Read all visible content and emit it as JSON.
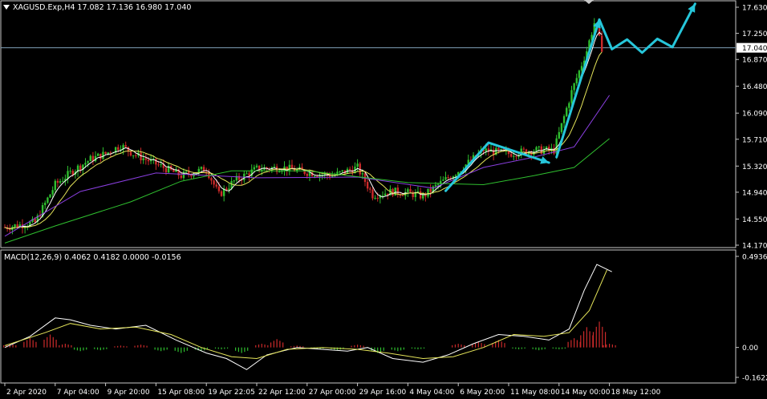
{
  "colors": {
    "background": "#000000",
    "frame": "#c8c8c8",
    "text": "#ffffff",
    "bull_candle": "#2fbf2f",
    "bear_candle": "#cc2a2a",
    "price_line": "#7f9fb8",
    "ma_fast": "#ffffff",
    "ma_mid": "#e6e65a",
    "ma_slow": "#8a3fe0",
    "ma_long": "#2fbf2f",
    "arrow": "#26c6da",
    "macd_line": "#ffffff",
    "signal_line": "#e6e65a",
    "hist_pos": "#cc2a2a",
    "hist_neg": "#2fbf2f"
  },
  "icons": {
    "symbol_marker": "triangle-down-icon",
    "scroll_marker": "triangle-down-icon"
  },
  "chart_data": [
    {
      "type": "candlestick",
      "title": "XAGUSD.Exp,H4  17.082 17.136 16.980 17.040",
      "current_price": 17.04,
      "current_price_label": "17.040",
      "yticks": [
        "17.630",
        "17.250",
        "16.870",
        "16.480",
        "16.090",
        "15.710",
        "15.320",
        "14.940",
        "14.550",
        "14.170"
      ],
      "ytick_values": [
        17.63,
        17.25,
        16.87,
        16.48,
        16.09,
        15.71,
        15.32,
        14.94,
        14.55,
        14.17
      ],
      "ylim": [
        14.17,
        17.63
      ],
      "x_categories": [
        "2 Apr 2020",
        "7 Apr 04:00",
        "9 Apr 20:00",
        "15 Apr 08:00",
        "19 Apr 22:05",
        "22 Apr 12:00",
        "27 Apr 00:00",
        "29 Apr 16:00",
        "4 May 04:00",
        "6 May 20:00",
        "11 May 08:00",
        "14 May 00:00",
        "18 May 12:00"
      ],
      "price_path": [
        {
          "t": 0,
          "v": 14.43
        },
        {
          "t": 0.6,
          "v": 14.5
        },
        {
          "t": 1.0,
          "v": 15.05
        },
        {
          "t": 1.35,
          "v": 15.25
        },
        {
          "t": 1.7,
          "v": 15.42
        },
        {
          "t": 2.0,
          "v": 15.5
        },
        {
          "t": 2.3,
          "v": 15.62
        },
        {
          "t": 2.55,
          "v": 15.5
        },
        {
          "t": 2.85,
          "v": 15.4
        },
        {
          "t": 3.0,
          "v": 15.35
        },
        {
          "t": 3.5,
          "v": 15.18
        },
        {
          "t": 4.0,
          "v": 15.28
        },
        {
          "t": 4.25,
          "v": 14.9
        },
        {
          "t": 4.55,
          "v": 15.1
        },
        {
          "t": 5.0,
          "v": 15.28
        },
        {
          "t": 5.5,
          "v": 15.3
        },
        {
          "t": 6.0,
          "v": 15.23
        },
        {
          "t": 6.5,
          "v": 15.18
        },
        {
          "t": 7.0,
          "v": 15.3
        },
        {
          "t": 7.3,
          "v": 14.9
        },
        {
          "t": 7.7,
          "v": 14.95
        },
        {
          "t": 8.0,
          "v": 14.93
        },
        {
          "t": 8.3,
          "v": 14.88
        },
        {
          "t": 8.6,
          "v": 15.05
        },
        {
          "t": 9.0,
          "v": 15.25
        },
        {
          "t": 9.5,
          "v": 15.55
        },
        {
          "t": 10.0,
          "v": 15.5
        },
        {
          "t": 10.5,
          "v": 15.55
        },
        {
          "t": 10.9,
          "v": 15.55
        },
        {
          "t": 11.25,
          "v": 16.4
        },
        {
          "t": 11.55,
          "v": 17.0
        },
        {
          "t": 11.7,
          "v": 17.4
        },
        {
          "t": 11.85,
          "v": 17.04
        }
      ],
      "moving_averages": [
        {
          "name": "",
          "color_key": "ma_slow",
          "points": [
            {
              "t": 0,
              "v": 14.3
            },
            {
              "t": 1.5,
              "v": 14.95
            },
            {
              "t": 3,
              "v": 15.22
            },
            {
              "t": 5,
              "v": 15.15
            },
            {
              "t": 7,
              "v": 15.16
            },
            {
              "t": 8.5,
              "v": 15.0
            },
            {
              "t": 9.5,
              "v": 15.3
            },
            {
              "t": 10.5,
              "v": 15.45
            },
            {
              "t": 11.3,
              "v": 15.6
            },
            {
              "t": 12.0,
              "v": 16.35
            }
          ]
        },
        {
          "name": "",
          "color_key": "ma_long",
          "points": [
            {
              "t": 0,
              "v": 14.2
            },
            {
              "t": 1,
              "v": 14.45
            },
            {
              "t": 2.5,
              "v": 14.8
            },
            {
              "t": 3.5,
              "v": 15.1
            },
            {
              "t": 4.5,
              "v": 15.25
            },
            {
              "t": 6,
              "v": 15.25
            },
            {
              "t": 8,
              "v": 15.08
            },
            {
              "t": 9.5,
              "v": 15.05
            },
            {
              "t": 10.5,
              "v": 15.18
            },
            {
              "t": 11.3,
              "v": 15.3
            },
            {
              "t": 12.0,
              "v": 15.72
            }
          ]
        }
      ],
      "forecast_arrows": [
        {
          "points": [
            {
              "t": 8.75,
              "v": 14.96
            },
            {
              "t": 9.6,
              "v": 15.66
            },
            {
              "t": 10.8,
              "v": 15.37
            }
          ]
        },
        {
          "points": [
            {
              "t": 10.95,
              "v": 15.45
            },
            {
              "t": 11.8,
              "v": 17.45
            }
          ]
        },
        {
          "points": [
            {
              "t": 11.8,
              "v": 17.45
            },
            {
              "t": 12.05,
              "v": 17.02
            },
            {
              "t": 12.35,
              "v": 17.16
            },
            {
              "t": 12.65,
              "v": 16.97
            },
            {
              "t": 12.95,
              "v": 17.17
            },
            {
              "t": 13.25,
              "v": 17.05
            },
            {
              "t": 13.7,
              "v": 17.68
            }
          ]
        }
      ]
    },
    {
      "type": "line",
      "title": "MACD(12,26,9) 0.4062 0.4182 0.0000 -0.0156",
      "yticks": [
        "0.4936",
        "0.00",
        "-0.1622"
      ],
      "ytick_values": [
        0.4936,
        0.0,
        -0.1622
      ],
      "ylim": [
        -0.1622,
        0.4936
      ],
      "series": [
        {
          "name": "",
          "color_key": "macd_line",
          "points": [
            {
              "t": 0,
              "v": 0.0
            },
            {
              "t": 0.5,
              "v": 0.06
            },
            {
              "t": 1.0,
              "v": 0.16
            },
            {
              "t": 1.3,
              "v": 0.15
            },
            {
              "t": 1.7,
              "v": 0.12
            },
            {
              "t": 2.2,
              "v": 0.1
            },
            {
              "t": 2.8,
              "v": 0.12
            },
            {
              "t": 3.4,
              "v": 0.04
            },
            {
              "t": 4.0,
              "v": -0.03
            },
            {
              "t": 4.4,
              "v": -0.06
            },
            {
              "t": 4.8,
              "v": -0.12
            },
            {
              "t": 5.2,
              "v": -0.04
            },
            {
              "t": 5.8,
              "v": 0.0
            },
            {
              "t": 6.3,
              "v": -0.01
            },
            {
              "t": 6.8,
              "v": -0.02
            },
            {
              "t": 7.2,
              "v": 0.0
            },
            {
              "t": 7.7,
              "v": -0.06
            },
            {
              "t": 8.3,
              "v": -0.08
            },
            {
              "t": 8.8,
              "v": -0.04
            },
            {
              "t": 9.3,
              "v": 0.02
            },
            {
              "t": 9.8,
              "v": 0.07
            },
            {
              "t": 10.3,
              "v": 0.06
            },
            {
              "t": 10.8,
              "v": 0.04
            },
            {
              "t": 11.2,
              "v": 0.1
            },
            {
              "t": 11.5,
              "v": 0.31
            },
            {
              "t": 11.75,
              "v": 0.45
            },
            {
              "t": 12.05,
              "v": 0.41
            }
          ]
        },
        {
          "name": "",
          "color_key": "signal_line",
          "points": [
            {
              "t": 0,
              "v": 0.01
            },
            {
              "t": 0.8,
              "v": 0.08
            },
            {
              "t": 1.3,
              "v": 0.13
            },
            {
              "t": 1.9,
              "v": 0.1
            },
            {
              "t": 2.6,
              "v": 0.11
            },
            {
              "t": 3.3,
              "v": 0.07
            },
            {
              "t": 3.9,
              "v": 0.0
            },
            {
              "t": 4.5,
              "v": -0.05
            },
            {
              "t": 5.0,
              "v": -0.06
            },
            {
              "t": 5.6,
              "v": -0.01
            },
            {
              "t": 6.3,
              "v": 0.0
            },
            {
              "t": 7.0,
              "v": -0.01
            },
            {
              "t": 7.6,
              "v": -0.03
            },
            {
              "t": 8.3,
              "v": -0.06
            },
            {
              "t": 8.9,
              "v": -0.05
            },
            {
              "t": 9.5,
              "v": 0.0
            },
            {
              "t": 10.1,
              "v": 0.07
            },
            {
              "t": 10.7,
              "v": 0.06
            },
            {
              "t": 11.2,
              "v": 0.08
            },
            {
              "t": 11.6,
              "v": 0.2
            },
            {
              "t": 11.95,
              "v": 0.42
            }
          ]
        }
      ],
      "histogram": [
        {
          "t": 0.1,
          "v": 0.02
        },
        {
          "t": 0.5,
          "v": 0.05
        },
        {
          "t": 0.9,
          "v": 0.07
        },
        {
          "t": 1.2,
          "v": 0.02
        },
        {
          "t": 1.5,
          "v": -0.02
        },
        {
          "t": 1.9,
          "v": -0.015
        },
        {
          "t": 2.3,
          "v": 0.01
        },
        {
          "t": 2.7,
          "v": 0.015
        },
        {
          "t": 3.1,
          "v": -0.02
        },
        {
          "t": 3.5,
          "v": -0.03
        },
        {
          "t": 3.9,
          "v": -0.02
        },
        {
          "t": 4.3,
          "v": -0.01
        },
        {
          "t": 4.7,
          "v": -0.03
        },
        {
          "t": 5.1,
          "v": 0.02
        },
        {
          "t": 5.4,
          "v": 0.045
        },
        {
          "t": 5.8,
          "v": 0.01
        },
        {
          "t": 6.2,
          "v": -0.01
        },
        {
          "t": 6.6,
          "v": -0.015
        },
        {
          "t": 7.0,
          "v": 0.015
        },
        {
          "t": 7.4,
          "v": -0.03
        },
        {
          "t": 7.8,
          "v": -0.02
        },
        {
          "t": 8.2,
          "v": -0.01
        },
        {
          "t": 8.6,
          "v": 0.0
        },
        {
          "t": 9.0,
          "v": 0.02
        },
        {
          "t": 9.4,
          "v": 0.03
        },
        {
          "t": 9.8,
          "v": 0.04
        },
        {
          "t": 10.2,
          "v": -0.01
        },
        {
          "t": 10.6,
          "v": -0.015
        },
        {
          "t": 11.0,
          "v": -0.01
        },
        {
          "t": 11.3,
          "v": 0.05
        },
        {
          "t": 11.55,
          "v": 0.11
        },
        {
          "t": 11.8,
          "v": 0.14
        },
        {
          "t": 12.0,
          "v": 0.02
        }
      ]
    }
  ]
}
